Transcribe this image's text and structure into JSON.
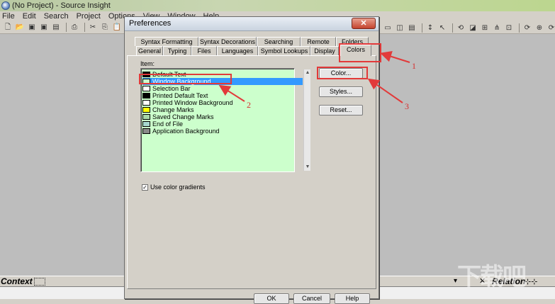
{
  "app": {
    "title": "(No Project) - Source Insight",
    "menu": [
      "File",
      "Edit",
      "Search",
      "Project",
      "Options",
      "View",
      "Window",
      "Help"
    ]
  },
  "toolbar_icons": [
    "new-file-icon",
    "open-folder-icon",
    "save-icon",
    "save-all-icon",
    "save-as-icon",
    "print-icon",
    "cut-icon",
    "copy-icon",
    "paste-icon"
  ],
  "dialog": {
    "title": "Preferences",
    "close_glyph": "✕",
    "tabs_back": [
      "Syntax Formatting",
      "Syntax Decorations",
      "Searching",
      "Remote",
      "Folders"
    ],
    "tabs_front": [
      "General",
      "Typing",
      "Files",
      "Languages",
      "Symbol Lookups",
      "Display",
      "Colors"
    ],
    "active_tab": "Colors",
    "item_label": "Item:",
    "items": [
      {
        "label": "Default Text",
        "color": "#000000"
      },
      {
        "label": "Window Background",
        "color": "#ccffcc",
        "selected": true
      },
      {
        "label": "Selection Bar",
        "color": "#ffffff"
      },
      {
        "label": "Printed Default Text",
        "color": "#000000"
      },
      {
        "label": "Printed Window Background",
        "color": "#ffffff"
      },
      {
        "label": "Change Marks",
        "color": "#ffff00"
      },
      {
        "label": "Saved Change Marks",
        "color": "#a8d8a8"
      },
      {
        "label": "End of File",
        "color": "#a8d8d0"
      },
      {
        "label": "Application Background",
        "color": "#8a8a8a"
      }
    ],
    "buttons": {
      "color": "Color...",
      "styles": "Styles...",
      "reset": "Reset..."
    },
    "checkbox": {
      "label": "Use color gradients",
      "checked": true
    },
    "footer": {
      "ok": "OK",
      "cancel": "Cancel",
      "help": "Help"
    }
  },
  "bottom": {
    "context": "Context",
    "relation": "Relation"
  },
  "annotations": [
    "1",
    "2",
    "3"
  ],
  "accent_color": "#e23a3a"
}
